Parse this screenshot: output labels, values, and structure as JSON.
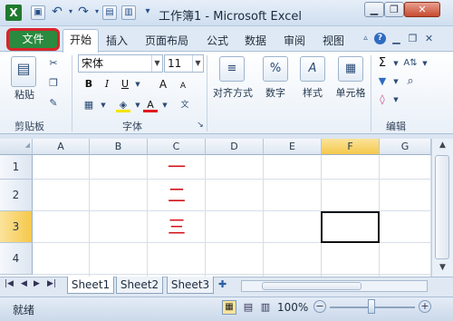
{
  "window": {
    "title": "工作簿1 - Microsoft Excel",
    "app_icon": "X",
    "minimize": "▁",
    "restore": "▫",
    "close": "✕",
    "caption_min": "▁",
    "caption_restore": "❐",
    "caption_close": "✕"
  },
  "qat": {
    "save": "▣",
    "undo": "↶",
    "redo": "↷",
    "new": "▤",
    "print": "▥",
    "customize": "▾"
  },
  "tabs": {
    "file": "文件",
    "home": "开始",
    "insert": "插入",
    "page_layout": "页面布局",
    "formulas": "公式",
    "data": "数据",
    "review": "审阅",
    "view": "视图"
  },
  "ribbon": {
    "clipboard": {
      "label": "剪贴板",
      "paste": "粘贴"
    },
    "font": {
      "label": "字体",
      "name": "宋体",
      "size": "11",
      "bold": "B",
      "italic": "I",
      "underline": "U",
      "grow": "A",
      "shrink": "A"
    },
    "alignment": {
      "label": "对齐方式"
    },
    "number": {
      "label": "数字",
      "glyph": "%"
    },
    "styles": {
      "label": "样式",
      "glyph": "A"
    },
    "cells": {
      "label": "单元格"
    },
    "editing": {
      "label": "编辑",
      "sum": "Σ",
      "sort": "A⇅",
      "find": "⌕"
    }
  },
  "grid": {
    "columns": [
      "A",
      "B",
      "C",
      "D",
      "E",
      "F",
      "G"
    ],
    "rows": [
      "1",
      "2",
      "3",
      "4"
    ],
    "cells": {
      "C1": "一",
      "C2": "二",
      "C3": "三"
    },
    "selected_column": "F",
    "selected_row": "3"
  },
  "sheets": [
    "Sheet1",
    "Sheet2",
    "Sheet3"
  ],
  "status": {
    "mode": "就绪",
    "zoom": "100%"
  },
  "colors": {
    "file_tab": "#2a8a3f",
    "highlight": "#d4262b",
    "cell_text": "#d0141c",
    "selected_header": "#f8cf5b"
  }
}
